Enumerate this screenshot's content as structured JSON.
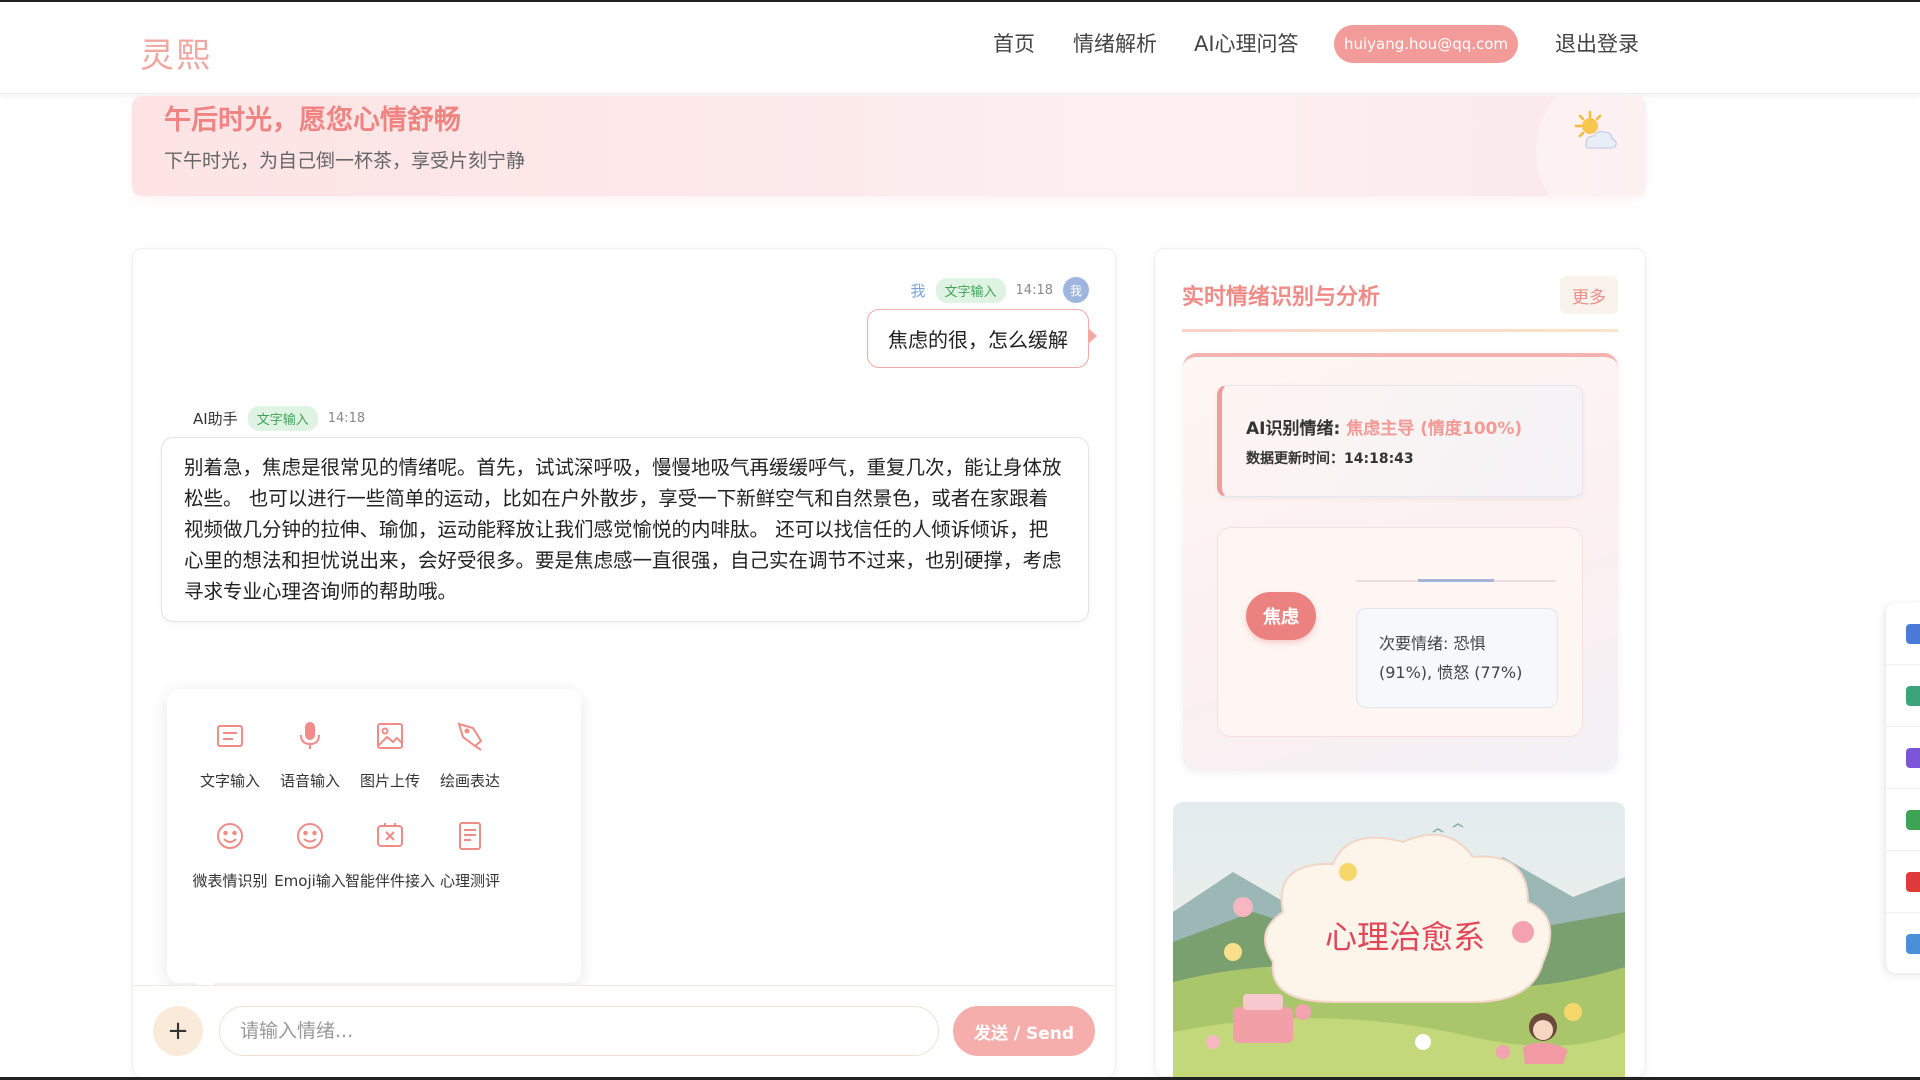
{
  "app": {
    "logo": "灵熙"
  },
  "nav": {
    "home": "首页",
    "emotion": "情绪解析",
    "ai_qa": "AI心理问答",
    "user_email": "huiyang.hou@qq.com",
    "logout": "退出登录"
  },
  "banner": {
    "title": "午后时光，愿您心情舒畅",
    "subtitle": "下午时光，为自己倒一杯茶，享受片刻宁静",
    "icon": "sun-behind-cloud-icon"
  },
  "chat": {
    "user_message": {
      "sender": "我",
      "input_type": "文字输入",
      "time": "14:18",
      "avatar": "我",
      "text": "焦虑的很，怎么缓解"
    },
    "ai_message": {
      "sender": "AI助手",
      "input_type": "文字输入",
      "time": "14:18",
      "text": "别着急，焦虑是很常见的情绪呢。首先，试试深呼吸，慢慢地吸气再缓缓呼气，重复几次，能让身体放松些。 也可以进行一些简单的运动，比如在户外散步，享受一下新鲜空气和自然景色，或者在家跟着视频做几分钟的拉伸、瑜伽，运动能释放让我们感觉愉悦的内啡肽。 还可以找信任的人倾诉倾诉，把心里的想法和担忧说出来，会好受很多。要是焦虑感一直很强，自己实在调节不过来，也别硬撑，考虑寻求专业心理咨询师的帮助哦。"
    },
    "tools": [
      {
        "label": "文字输入",
        "icon": "text-input-icon"
      },
      {
        "label": "语音输入",
        "icon": "microphone-icon"
      },
      {
        "label": "图片上传",
        "icon": "image-upload-icon"
      },
      {
        "label": "绘画表达",
        "icon": "drawing-icon"
      },
      {
        "label": "微表情识别",
        "icon": "smile-face-icon"
      },
      {
        "label": "Emoji输入",
        "icon": "emoji-icon"
      },
      {
        "label": "智能伴件接入",
        "icon": "device-icon"
      },
      {
        "label": "心理测评",
        "icon": "assessment-icon"
      }
    ],
    "input_placeholder": "请输入情绪...",
    "plus_label": "+",
    "send_label": "发送 / Send"
  },
  "analysis": {
    "title": "实时情绪识别与分析",
    "more": "更多",
    "ai_detect_label": "AI识别情绪: ",
    "ai_detect_value": "焦虑主导 (情度100%)",
    "update_time": "数据更新时间：14:18:43",
    "primary_emotion": "焦虑",
    "secondary_emotions": "次要情绪: 恐惧 (91%), 愤怒 (77%)",
    "healing_caption": "心理治愈系"
  },
  "colors": {
    "accent": "#ef8c88",
    "accent_soft": "#f5aeab",
    "badge_green": "#3fa356"
  },
  "dock_icons": [
    "blue-shape-icon",
    "user-icon",
    "purple-shape-icon",
    "chart-icon",
    "music-icon",
    "compass-icon"
  ]
}
